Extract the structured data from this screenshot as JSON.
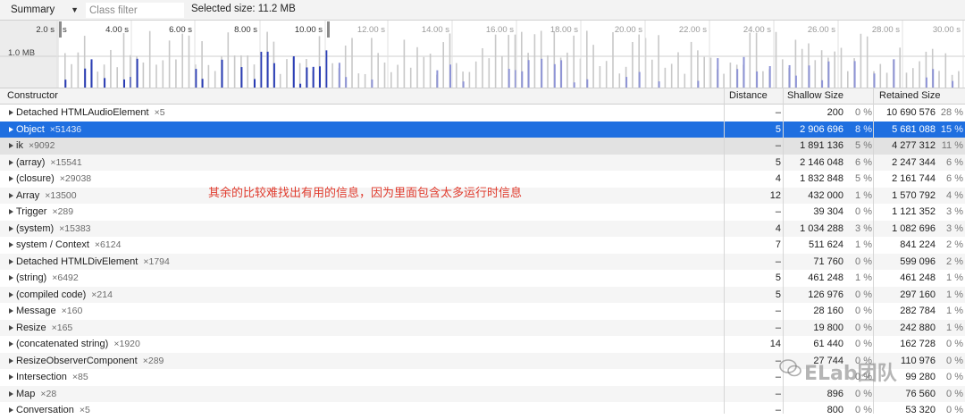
{
  "toolbar": {
    "view_label": "Summary",
    "class_filter_placeholder": "Class filter",
    "selected_size": "Selected size: 11.2 MB"
  },
  "overview": {
    "y_label": "1.0 MB",
    "ticks": [
      "2.0 s",
      "4.00 s",
      "6.00 s",
      "8.00 s",
      "10.00 s",
      "12.00 s",
      "14.00 s",
      "16.00 s",
      "18.00 s",
      "20.00 s",
      "22.00 s",
      "24.00 s",
      "26.00 s",
      "28.00 s",
      "30.00 s"
    ],
    "colors": {
      "active_bar": "#2a3db5",
      "inactive_bar": "#c8c8c8",
      "muted_active": "#8e94d6"
    }
  },
  "columns": {
    "constructor": "Constructor",
    "distance": "Distance",
    "shallow": "Shallow Size",
    "retained": "Retained Size"
  },
  "rows": [
    {
      "name": "Detached HTMLAudioElement",
      "count": "×5",
      "distance": "–",
      "shallow": "200",
      "shallow_pct": "0 %",
      "retained": "10 690 576",
      "retained_pct": "28 %"
    },
    {
      "name": "Object",
      "count": "×51436",
      "distance": "5",
      "shallow": "2 906 696",
      "shallow_pct": "8 %",
      "retained": "5 681 088",
      "retained_pct": "15 %"
    },
    {
      "name": "ik",
      "count": "×9092",
      "distance": "–",
      "shallow": "1 891 136",
      "shallow_pct": "5 %",
      "retained": "4 277 312",
      "retained_pct": "11 %"
    },
    {
      "name": "(array)",
      "count": "×15541",
      "distance": "5",
      "shallow": "2 146 048",
      "shallow_pct": "6 %",
      "retained": "2 247 344",
      "retained_pct": "6 %"
    },
    {
      "name": "(closure)",
      "count": "×29038",
      "distance": "4",
      "shallow": "1 832 848",
      "shallow_pct": "5 %",
      "retained": "2 161 744",
      "retained_pct": "6 %"
    },
    {
      "name": "Array",
      "count": "×13500",
      "distance": "12",
      "shallow": "432 000",
      "shallow_pct": "1 %",
      "retained": "1 570 792",
      "retained_pct": "4 %"
    },
    {
      "name": "Trigger",
      "count": "×289",
      "distance": "–",
      "shallow": "39 304",
      "shallow_pct": "0 %",
      "retained": "1 121 352",
      "retained_pct": "3 %"
    },
    {
      "name": "(system)",
      "count": "×15383",
      "distance": "4",
      "shallow": "1 034 288",
      "shallow_pct": "3 %",
      "retained": "1 082 696",
      "retained_pct": "3 %"
    },
    {
      "name": "system / Context",
      "count": "×6124",
      "distance": "7",
      "shallow": "511 624",
      "shallow_pct": "1 %",
      "retained": "841 224",
      "retained_pct": "2 %"
    },
    {
      "name": "Detached HTMLDivElement",
      "count": "×1794",
      "distance": "–",
      "shallow": "71 760",
      "shallow_pct": "0 %",
      "retained": "599 096",
      "retained_pct": "2 %"
    },
    {
      "name": "(string)",
      "count": "×6492",
      "distance": "5",
      "shallow": "461 248",
      "shallow_pct": "1 %",
      "retained": "461 248",
      "retained_pct": "1 %"
    },
    {
      "name": "(compiled code)",
      "count": "×214",
      "distance": "5",
      "shallow": "126 976",
      "shallow_pct": "0 %",
      "retained": "297 160",
      "retained_pct": "1 %"
    },
    {
      "name": "Message",
      "count": "×160",
      "distance": "–",
      "shallow": "28 160",
      "shallow_pct": "0 %",
      "retained": "282 784",
      "retained_pct": "1 %"
    },
    {
      "name": "Resize",
      "count": "×165",
      "distance": "–",
      "shallow": "19 800",
      "shallow_pct": "0 %",
      "retained": "242 880",
      "retained_pct": "1 %"
    },
    {
      "name": "(concatenated string)",
      "count": "×1920",
      "distance": "14",
      "shallow": "61 440",
      "shallow_pct": "0 %",
      "retained": "162 728",
      "retained_pct": "0 %"
    },
    {
      "name": "ResizeObserverComponent",
      "count": "×289",
      "distance": "–",
      "shallow": "27 744",
      "shallow_pct": "0 %",
      "retained": "110 976",
      "retained_pct": "0 %"
    },
    {
      "name": "Intersection",
      "count": "×85",
      "distance": "–",
      "shallow": "",
      "shallow_pct": "0 %",
      "retained": "99 280",
      "retained_pct": "0 %"
    },
    {
      "name": "Map",
      "count": "×28",
      "distance": "–",
      "shallow": "896",
      "shallow_pct": "0 %",
      "retained": "76 560",
      "retained_pct": "0 %"
    },
    {
      "name": "Conversation",
      "count": "×5",
      "distance": "–",
      "shallow": "800",
      "shallow_pct": "0 %",
      "retained": "53 320",
      "retained_pct": "0 %"
    }
  ],
  "annotation": "其余的比较难找出有用的信息，因为里面包含太多运行时信息",
  "watermark": "ELab团队"
}
